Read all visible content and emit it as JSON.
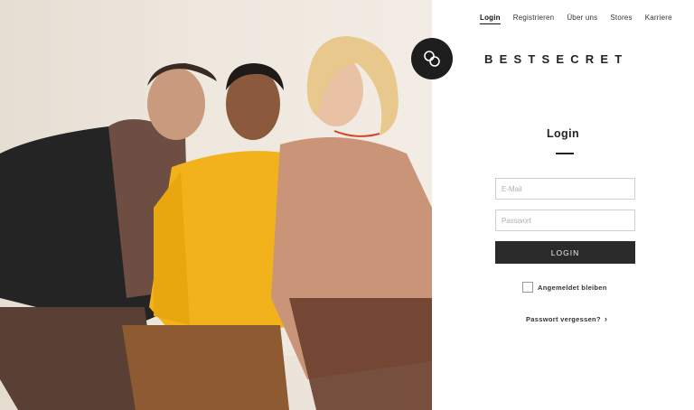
{
  "nav": {
    "items": [
      {
        "label": "Login"
      },
      {
        "label": "Registrieren"
      },
      {
        "label": "Über uns"
      },
      {
        "label": "Stores"
      },
      {
        "label": "Karriere"
      }
    ]
  },
  "brand": {
    "name": "BESTSECRET"
  },
  "form": {
    "title": "Login",
    "email_placeholder": "E-Mail",
    "password_placeholder": "Passwort",
    "submit_label": "LOGIN",
    "remember_label": "Angemeldet bleiben",
    "forgot_label": "Passwort vergessen?"
  },
  "colors": {
    "button": "#2a2a2a",
    "logo": "#1e1e1e"
  }
}
